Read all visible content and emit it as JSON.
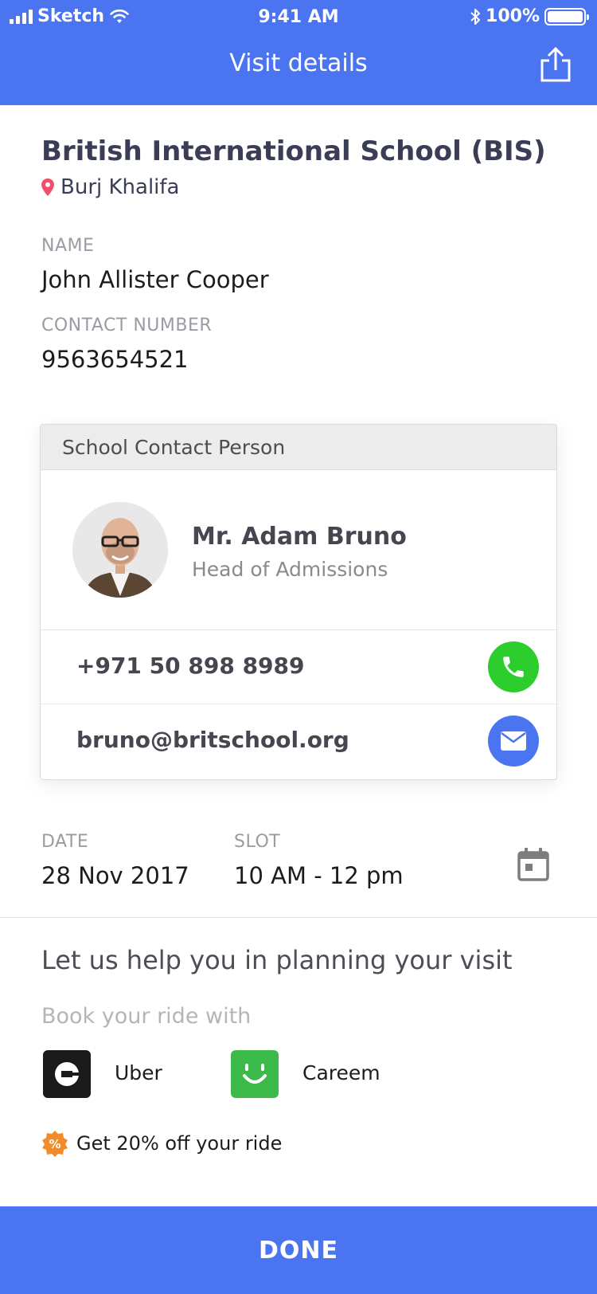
{
  "status_bar": {
    "carrier": "Sketch",
    "time": "9:41 AM",
    "battery": "100%"
  },
  "nav": {
    "title": "Visit details",
    "share_icon": "share-icon"
  },
  "school": {
    "name": "British International School (BIS)",
    "location": "Burj Khalifa"
  },
  "visitor": {
    "name_label": "NAME",
    "name_value": "John Allister Cooper",
    "contact_label": "CONTACT NUMBER",
    "contact_value": "9563654521"
  },
  "contact_card": {
    "header": "School Contact Person",
    "person_name": "Mr. Adam Bruno",
    "person_role": "Head of Admissions",
    "phone": "+971 50 898 8989",
    "email": "bruno@britschool.org"
  },
  "visit": {
    "date_label": "DATE",
    "date_value": "28 Nov 2017",
    "slot_label": "SLOT",
    "slot_value": "10 AM - 12 pm"
  },
  "planning": {
    "title": "Let us help you in planning your visit",
    "book_label": "Book your ride with",
    "rides": [
      "Uber",
      "Careem"
    ],
    "promo": "Get 20% off your ride"
  },
  "footer": {
    "done_label": "DONE"
  },
  "colors": {
    "primary": "#4a74f0",
    "call_green": "#2dcd2d",
    "careem_green": "#3dbb4a",
    "promo_orange": "#f28c28",
    "location_pin": "#f0506e"
  }
}
